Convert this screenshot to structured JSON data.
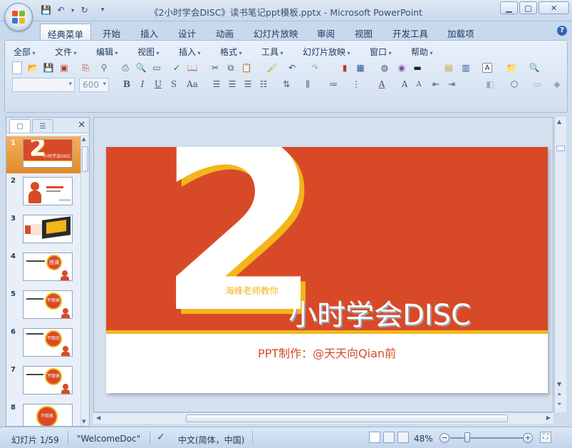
{
  "window": {
    "title": "《2小时学会DISC》读书笔记ppt模板.pptx - Microsoft PowerPoint",
    "minimize_icon": "minimize-icon",
    "maximize_icon": "maximize-icon",
    "close_icon": "close-icon"
  },
  "ribbon_tabs": [
    "经典菜单",
    "开始",
    "插入",
    "设计",
    "动画",
    "幻灯片放映",
    "审阅",
    "视图",
    "开发工具",
    "加载项"
  ],
  "classic_menu": [
    "全部",
    "文件",
    "编辑",
    "视图",
    "插入",
    "格式",
    "工具",
    "幻灯片放映",
    "窗口",
    "帮助"
  ],
  "font_size_value": "600",
  "font_name_value": "",
  "slides_panel": {
    "close_glyph": "✕",
    "slide_numbers": [
      "1",
      "2",
      "3",
      "4",
      "5",
      "6",
      "7",
      "8"
    ],
    "thumb1_title": "小时学会DISC",
    "thumb4_label": "授课",
    "thumb5_label": "不观表",
    "thumb6_label": "不观念",
    "thumb7_label": "不观表",
    "thumb8_label": "不观表"
  },
  "slide": {
    "big_numeral": "2",
    "teacher": "海峰老师教你",
    "title": "小时学会DISC",
    "credit": "PPT制作：@天天向Qian前"
  },
  "status": {
    "slide_indicator": "幻灯片 1/59",
    "theme": "\"WelcomeDoc\"",
    "language": "中文(简体，中国)",
    "zoom": "48%",
    "zoom_level": 0.48
  },
  "colors": {
    "slide_red": "#d84a27",
    "slide_yellow": "#f2b61b",
    "ribbon_bg": "#dbe6f4"
  }
}
